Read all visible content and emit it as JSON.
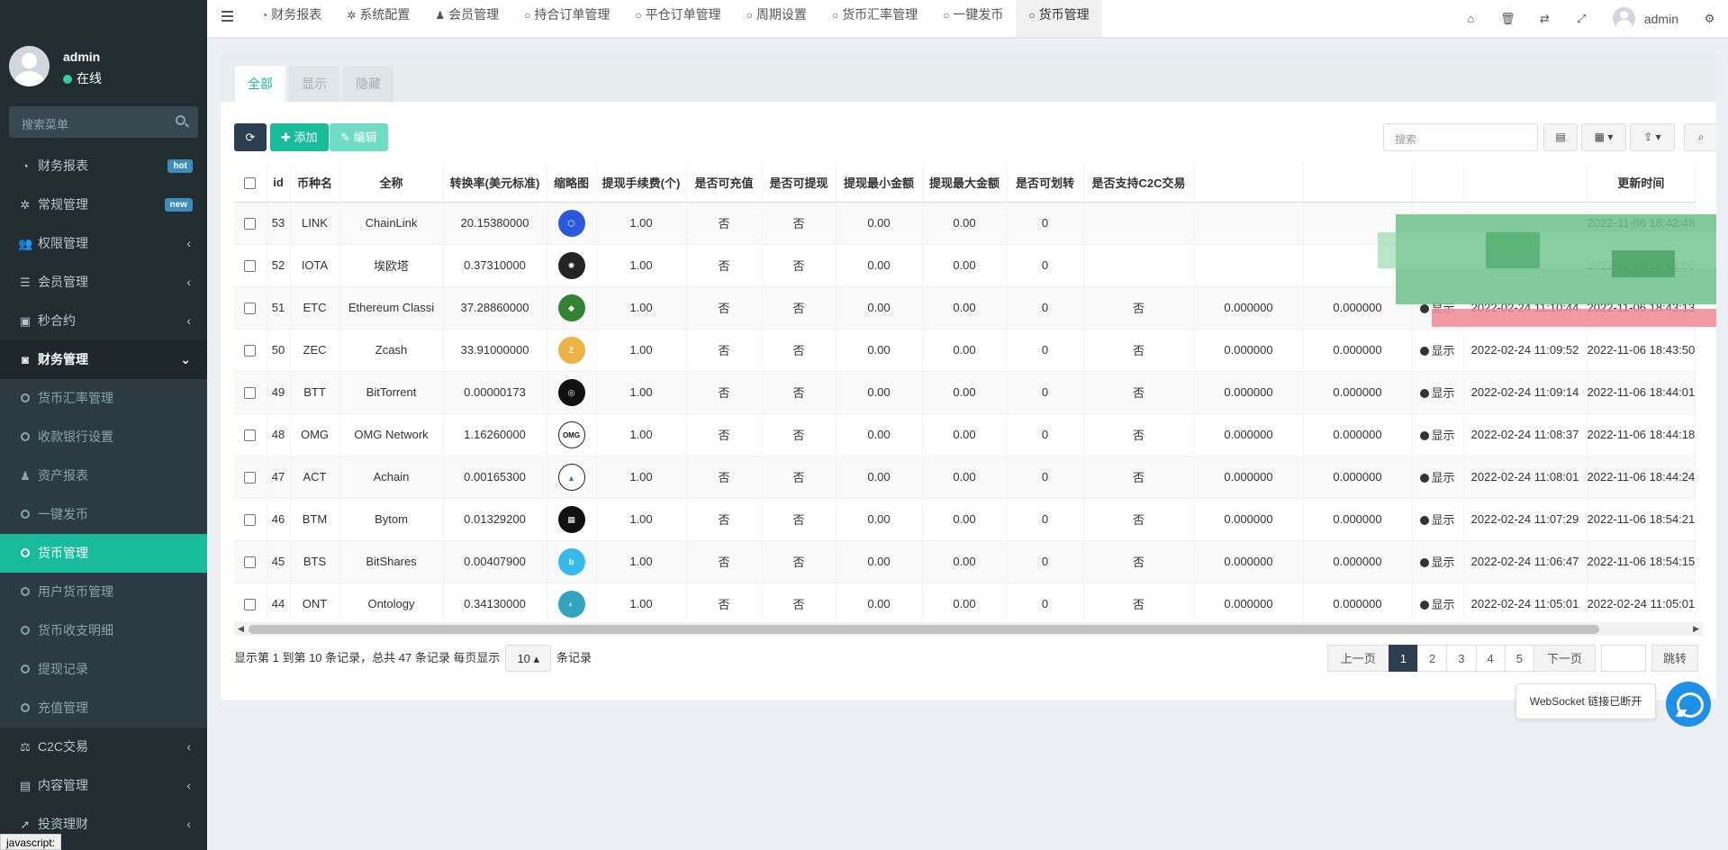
{
  "sidebar": {
    "user": {
      "name": "admin",
      "status": "在线"
    },
    "search_placeholder": "搜索菜单",
    "items": [
      {
        "label": "财务报表",
        "icon": "dashboard-icon",
        "badge": "hot",
        "badge_color": "#3c8dbc"
      },
      {
        "label": "常规管理",
        "icon": "cogs-icon",
        "badge": "new",
        "badge_color": "#3c8dbc"
      },
      {
        "label": "权限管理",
        "icon": "users-icon"
      },
      {
        "label": "会员管理",
        "icon": "list-icon"
      },
      {
        "label": "秒合约",
        "icon": "calendar-icon"
      },
      {
        "label": "财务管理",
        "icon": "database-icon"
      }
    ],
    "sub_items": [
      {
        "label": "货币汇率管理",
        "icon": "circle-icon"
      },
      {
        "label": "收款银行设置",
        "icon": "circle-icon"
      },
      {
        "label": "资产报表",
        "icon": "user-icon"
      },
      {
        "label": "一键发币",
        "icon": "circle-icon"
      },
      {
        "label": "货币管理",
        "icon": "circle-icon"
      },
      {
        "label": "用户货币管理",
        "icon": "circle-icon"
      },
      {
        "label": "货币收支明细",
        "icon": "circle-icon"
      },
      {
        "label": "提现记录",
        "icon": "circle-icon"
      },
      {
        "label": "充值管理",
        "icon": "circle-icon"
      }
    ],
    "bottom_items": [
      {
        "label": "C2C交易",
        "icon": "balance-scale-icon"
      },
      {
        "label": "内容管理",
        "icon": "file-text-icon"
      },
      {
        "label": "投资理财",
        "icon": "rocket-icon"
      }
    ]
  },
  "statusbar": "javascript:",
  "topbar": {
    "tabs": [
      "财务报表",
      "系统配置",
      "会员管理",
      "持合订单管理",
      "平仓订单管理",
      "周期设置",
      "货币汇率管理",
      "一键发币",
      "货币管理"
    ],
    "user": "admin"
  },
  "panel": {
    "tabs": [
      "全部",
      "显示",
      "隐藏"
    ],
    "add_label": "添加",
    "edit_label": "编辑",
    "search_placeholder": "搜索"
  },
  "table": {
    "headers": [
      "id",
      "币种名",
      "全称",
      "转换率(美元标准)",
      "缩略图",
      "提现手续费(个)",
      "是否可充值",
      "是否可提现",
      "提现最小金额",
      "提现最大金额",
      "是否可划转",
      "是否支持C2C交易",
      "",
      "",
      "",
      "",
      "更新时间"
    ],
    "rows": [
      {
        "id": "53",
        "sym": "LINK",
        "name": "ChainLink",
        "rate": "20.15380000",
        "fee": "1.00",
        "dep": "否",
        "wd": "否",
        "min": "0.00",
        "max": "0.00",
        "tr": "0",
        "c2c": "",
        "a": "",
        "b": "",
        "show": "",
        "created": "",
        "updated": "2022-11-06 18:42:48",
        "color": "#2a5ada",
        "glyph": "⬡"
      },
      {
        "id": "52",
        "sym": "IOTA",
        "name": "埃欧塔",
        "rate": "0.37310000",
        "fee": "1.00",
        "dep": "否",
        "wd": "否",
        "min": "0.00",
        "max": "0.00",
        "tr": "0",
        "c2c": "",
        "a": "",
        "b": "",
        "show": "",
        "created": "",
        "updated": "2022-11-06 18:43:06",
        "color": "#242424",
        "glyph": "✺"
      },
      {
        "id": "51",
        "sym": "ETC",
        "name": "Ethereum Classi",
        "rate": "37.28860000",
        "fee": "1.00",
        "dep": "否",
        "wd": "否",
        "min": "0.00",
        "max": "0.00",
        "tr": "0",
        "c2c": "否",
        "a": "0.000000",
        "b": "0.000000",
        "show": "显示",
        "created": "2022-02-24 11:10:44",
        "updated": "2022-11-06 18:43:13",
        "color": "#328432",
        "glyph": "◆"
      },
      {
        "id": "50",
        "sym": "ZEC",
        "name": "Zcash",
        "rate": "33.91000000",
        "fee": "1.00",
        "dep": "否",
        "wd": "否",
        "min": "0.00",
        "max": "0.00",
        "tr": "0",
        "c2c": "否",
        "a": "0.000000",
        "b": "0.000000",
        "show": "显示",
        "created": "2022-02-24 11:09:52",
        "updated": "2022-11-06 18:43:50",
        "color": "#ecb244",
        "glyph": "Z"
      },
      {
        "id": "49",
        "sym": "BTT",
        "name": "BitTorrent",
        "rate": "0.00000173",
        "fee": "1.00",
        "dep": "否",
        "wd": "否",
        "min": "0.00",
        "max": "0.00",
        "tr": "0",
        "c2c": "否",
        "a": "0.000000",
        "b": "0.000000",
        "show": "显示",
        "created": "2022-02-24 11:09:14",
        "updated": "2022-11-06 18:44:01",
        "color": "#111111",
        "glyph": "◎"
      },
      {
        "id": "48",
        "sym": "OMG",
        "name": "OMG Network",
        "rate": "1.16260000",
        "fee": "1.00",
        "dep": "否",
        "wd": "否",
        "min": "0.00",
        "max": "0.00",
        "tr": "0",
        "c2c": "否",
        "a": "0.000000",
        "b": "0.000000",
        "show": "显示",
        "created": "2022-02-24 11:08:37",
        "updated": "2022-11-06 18:44:18",
        "color": "#ffffff",
        "glyph": "OMG"
      },
      {
        "id": "47",
        "sym": "ACT",
        "name": "Achain",
        "rate": "0.00165300",
        "fee": "1.00",
        "dep": "否",
        "wd": "否",
        "min": "0.00",
        "max": "0.00",
        "tr": "0",
        "c2c": "否",
        "a": "0.000000",
        "b": "0.000000",
        "show": "显示",
        "created": "2022-02-24 11:08:01",
        "updated": "2022-11-06 18:44:24",
        "color": "#ffffff",
        "glyph": "▲"
      },
      {
        "id": "46",
        "sym": "BTM",
        "name": "Bytom",
        "rate": "0.01329200",
        "fee": "1.00",
        "dep": "否",
        "wd": "否",
        "min": "0.00",
        "max": "0.00",
        "tr": "0",
        "c2c": "否",
        "a": "0.000000",
        "b": "0.000000",
        "show": "显示",
        "created": "2022-02-24 11:07:29",
        "updated": "2022-11-06 18:54:21",
        "color": "#111111",
        "glyph": "▦"
      },
      {
        "id": "45",
        "sym": "BTS",
        "name": "BitShares",
        "rate": "0.00407900",
        "fee": "1.00",
        "dep": "否",
        "wd": "否",
        "min": "0.00",
        "max": "0.00",
        "tr": "0",
        "c2c": "否",
        "a": "0.000000",
        "b": "0.000000",
        "show": "显示",
        "created": "2022-02-24 11:06:47",
        "updated": "2022-11-06 18:54:15",
        "color": "#35baeb",
        "glyph": "b"
      },
      {
        "id": "44",
        "sym": "ONT",
        "name": "Ontology",
        "rate": "0.34130000",
        "fee": "1.00",
        "dep": "否",
        "wd": "否",
        "min": "0.00",
        "max": "0.00",
        "tr": "0",
        "c2c": "否",
        "a": "0.000000",
        "b": "0.000000",
        "show": "显示",
        "created": "2022-02-24 11:05:01",
        "updated": "2022-02-24 11:05:01",
        "color": "#32a4be",
        "glyph": "◐"
      }
    ]
  },
  "footer": {
    "summary": "显示第 1 到第 10 条记录，总共 47 条记录 每页显示",
    "page_size": "10",
    "suffix": "条记录",
    "prev": "上一页",
    "pages": [
      "1",
      "2",
      "3",
      "4",
      "5"
    ],
    "next": "下一页",
    "go": "跳转"
  },
  "websocket": "WebSocket 链接已断开"
}
